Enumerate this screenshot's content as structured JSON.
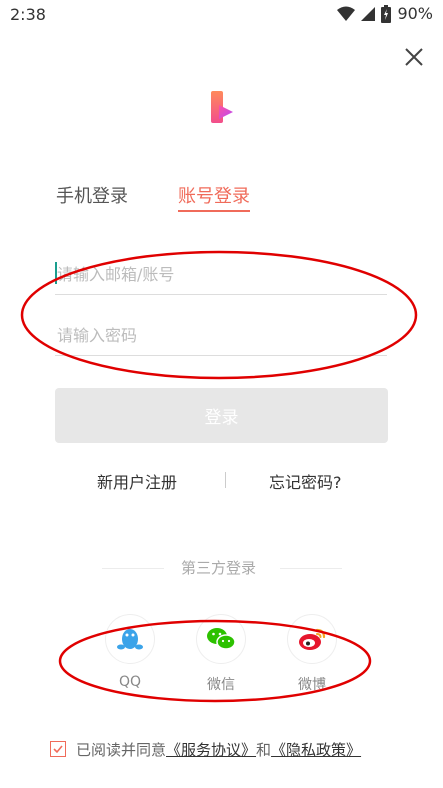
{
  "status_bar": {
    "time": "2:38",
    "battery": "90%",
    "icons": [
      "wifi-icon",
      "cellular-icon",
      "battery-icon"
    ]
  },
  "header": {
    "close_icon": "close-icon",
    "logo_icon": "app-logo"
  },
  "tabs": [
    {
      "label": "手机登录",
      "active": false
    },
    {
      "label": "账号登录",
      "active": true
    }
  ],
  "form": {
    "email": {
      "value": "",
      "placeholder": "请输入邮箱/账号"
    },
    "password": {
      "value": "",
      "placeholder": "请输入密码"
    },
    "login_label": "登录"
  },
  "links": {
    "register": "新用户注册",
    "forgot": "忘记密码?"
  },
  "third_party": {
    "title": "第三方登录",
    "providers": [
      {
        "label": "QQ",
        "icon": "qq-icon"
      },
      {
        "label": "微信",
        "icon": "wechat-icon"
      },
      {
        "label": "微博",
        "icon": "weibo-icon"
      }
    ]
  },
  "agreement": {
    "checked": true,
    "prefix": "已阅读并同意",
    "terms": "《服务协议》",
    "and": "和",
    "privacy": "《隐私政策》"
  },
  "colors": {
    "accent": "#f06b5a",
    "button_disabled": "#e7e7e7",
    "annotation": "#e00000"
  }
}
